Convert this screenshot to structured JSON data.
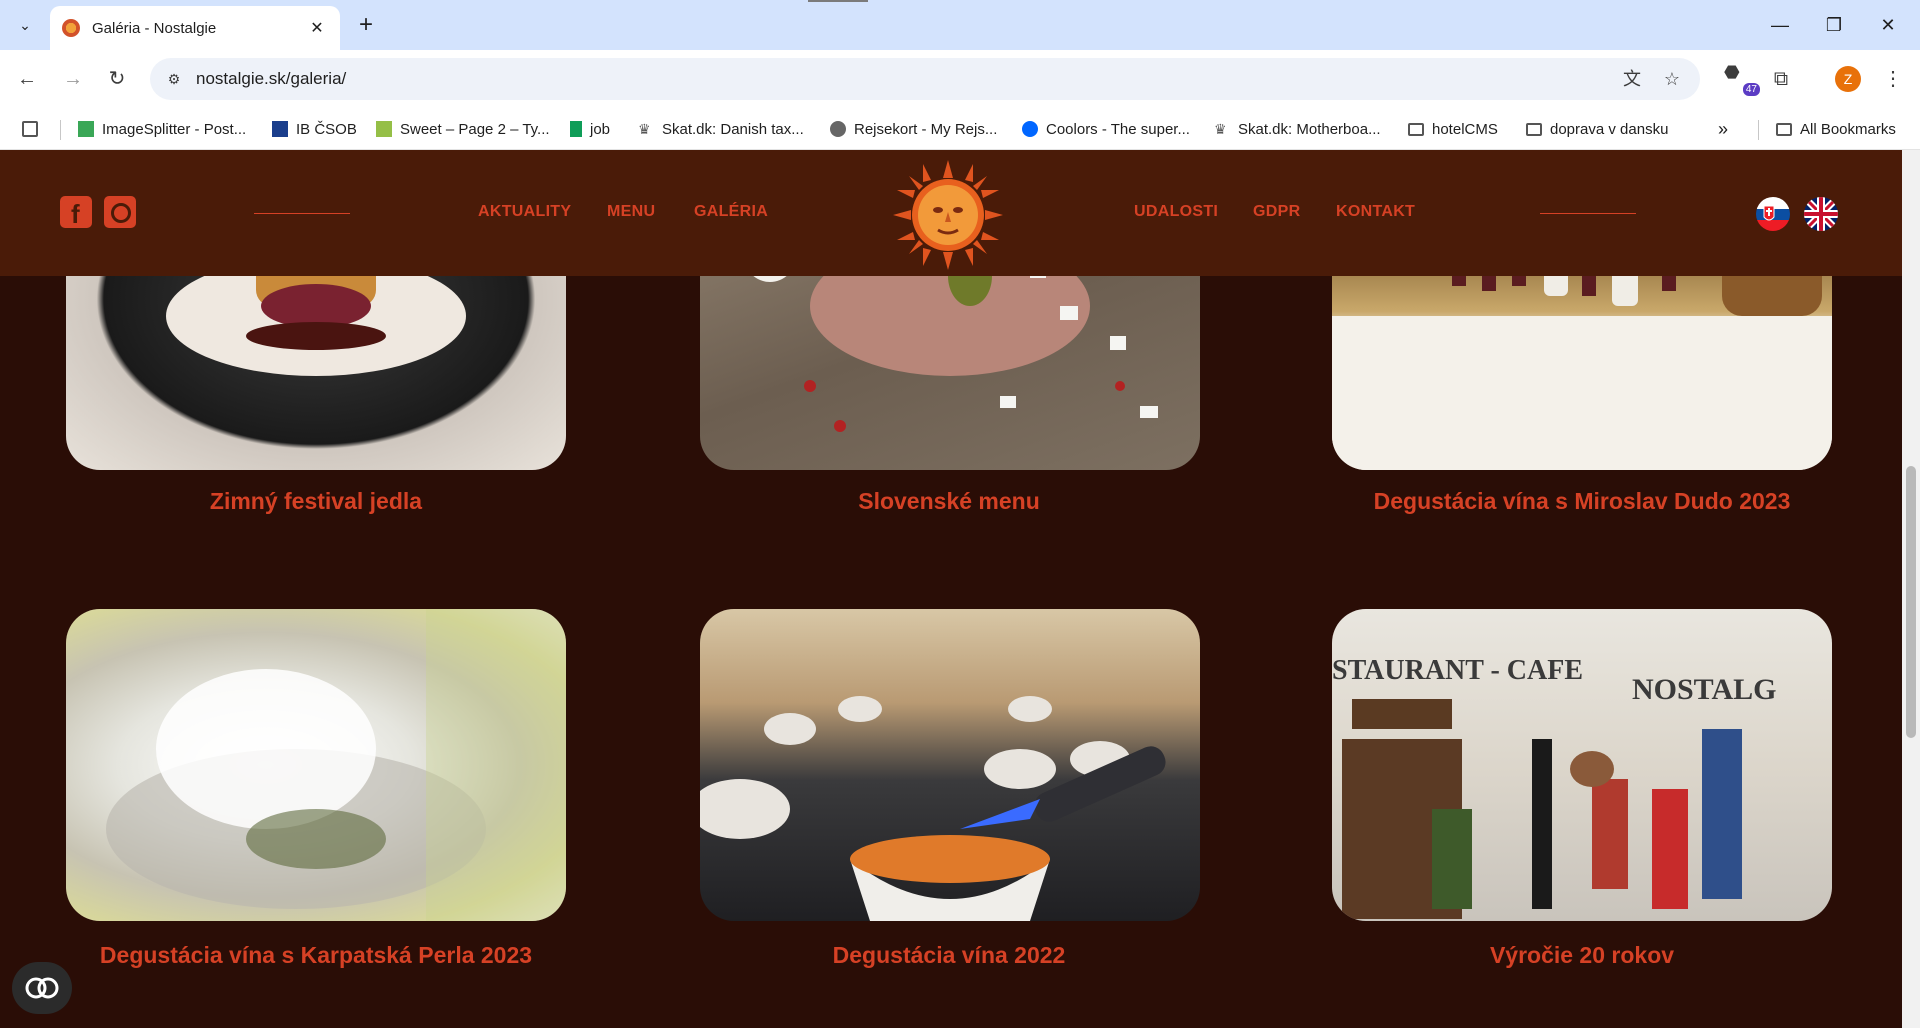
{
  "browser": {
    "tab_title": "Galéria - Nostalgie",
    "url": "nostalgie.sk/galeria/",
    "extension_count": "47",
    "profile_initial": "Z",
    "bookmarks": [
      {
        "label": "ImageSplitter - Post..."
      },
      {
        "label": "IB ČSOB"
      },
      {
        "label": "Sweet – Page 2 – Ty..."
      },
      {
        "label": "job"
      },
      {
        "label": "Skat.dk: Danish tax..."
      },
      {
        "label": "Rejsekort - My Rejs..."
      },
      {
        "label": "Coolors - The super..."
      },
      {
        "label": "Skat.dk: Motherboa..."
      },
      {
        "label": "hotelCMS"
      },
      {
        "label": "doprava v dansku"
      }
    ],
    "all_bookmarks": "All Bookmarks"
  },
  "site": {
    "nav_left": [
      "AKTUALITY",
      "MENU",
      "GALÉRIA"
    ],
    "nav_right": [
      "UDALOSTI",
      "GDPR",
      "KONTAKT"
    ]
  },
  "gallery": [
    {
      "title": "Zimný festival jedla",
      "icon": "plated-steak-photo"
    },
    {
      "title": "Slovenské menu",
      "icon": "tartare-photo"
    },
    {
      "title": "Degustácia vína s Miroslav Dudo 2023",
      "icon": "wine-table-photo"
    },
    {
      "title": "Degustácia vína s Karpatská Perla 2023",
      "icon": "smoke-dish-photo"
    },
    {
      "title": "Degustácia vína 2022",
      "icon": "flambe-cups-photo"
    },
    {
      "title": "Výročie 20 rokov",
      "icon": "restaurant-anniversary-photo"
    }
  ],
  "colors": {
    "header_bg": "#4a1b08",
    "page_bg": "#2a0d06",
    "accent": "#d64125"
  }
}
